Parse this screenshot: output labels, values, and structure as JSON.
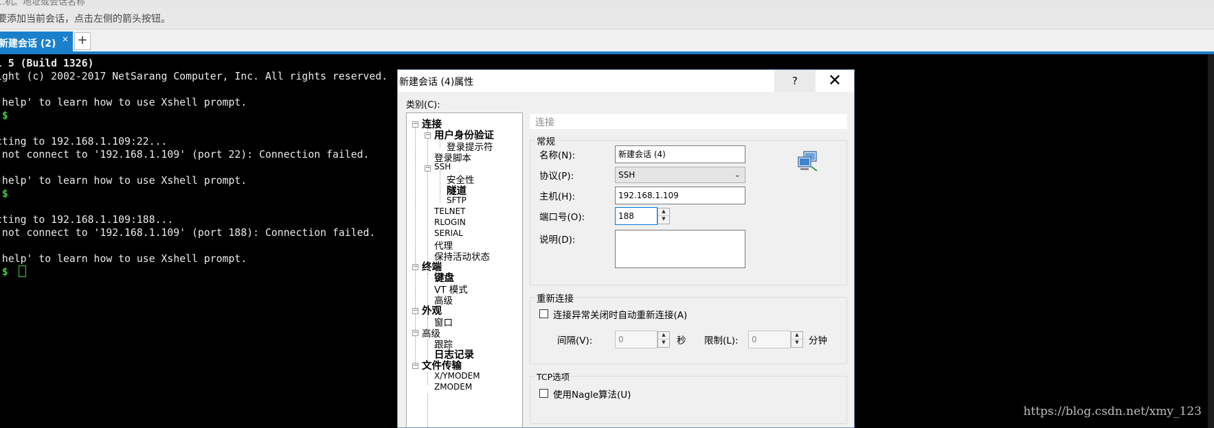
{
  "top_partial": "…机。地址或会话名称",
  "hint": "要添加当前会话，点击左侧的箭头按钮。",
  "tab": {
    "label": "新建会话 (2)",
    "close": "×",
    "add": "+"
  },
  "terminal": {
    "lines": [
      "l 5 (Build 1326)",
      "ight (c) 2002-2017 NetSarang Computer, Inc. All rights reserved.",
      "",
      "`help' to learn how to use Xshell prompt.",
      "]$",
      "",
      "cting to 192.168.1.109:22...",
      " not connect to '192.168.1.109' (port 22): Connection failed.",
      "",
      "`help' to learn how to use Xshell prompt.",
      "]$",
      "",
      "cting to 192.168.1.109:188...",
      " not connect to '192.168.1.109' (port 188): Connection failed.",
      "",
      "`help' to learn how to use Xshell prompt.",
      "]$ "
    ],
    "watermark": "https://blog.csdn.net/xmy_123"
  },
  "dialog": {
    "title": "新建会话 (4)属性",
    "help": "?",
    "close": "✕",
    "category_label": "类别(C):",
    "tree": [
      {
        "label": "连接"
      },
      {
        "label": "用户身份验证"
      },
      {
        "label": "登录提示符"
      },
      {
        "label": "登录脚本"
      },
      {
        "label": "SSH"
      },
      {
        "label": "安全性"
      },
      {
        "label": "隧道"
      },
      {
        "label": "SFTP"
      },
      {
        "label": "TELNET"
      },
      {
        "label": "RLOGIN"
      },
      {
        "label": "SERIAL"
      },
      {
        "label": "代理"
      },
      {
        "label": "保持活动状态"
      },
      {
        "label": "终端"
      },
      {
        "label": "键盘"
      },
      {
        "label": "VT 模式"
      },
      {
        "label": "高级"
      },
      {
        "label": "外观"
      },
      {
        "label": "窗口"
      },
      {
        "label": "高级"
      },
      {
        "label": "跟踪"
      },
      {
        "label": "日志记录"
      },
      {
        "label": "文件传输"
      },
      {
        "label": "X/YMODEM"
      },
      {
        "label": "ZMODEM"
      }
    ],
    "section_header": "连接",
    "general": {
      "title": "常规",
      "name_label": "名称(N):",
      "name_value": "新建会话 (4)",
      "protocol_label": "协议(P):",
      "protocol_value": "SSH",
      "host_label": "主机(H):",
      "host_value": "192.168.1.109",
      "port_label": "端口号(O):",
      "port_value": "188",
      "desc_label": "说明(D):",
      "desc_value": ""
    },
    "reconnect": {
      "title": "重新连接",
      "checkbox_label": "连接异常关闭时自动重新连接(A)",
      "interval_label": "间隔(V):",
      "interval_value": "0",
      "interval_unit": "秒",
      "limit_label": "限制(L):",
      "limit_value": "0",
      "limit_unit": "分钟"
    },
    "tcp": {
      "title": "TCP选项",
      "checkbox_label": "使用Nagle算法(U)"
    }
  }
}
